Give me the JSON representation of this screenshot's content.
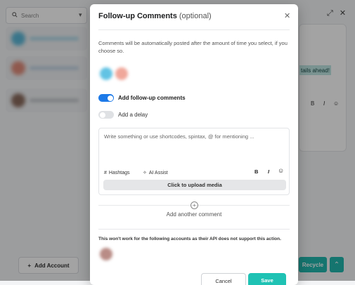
{
  "background": {
    "search": {
      "placeholder": "Search"
    },
    "add_account_label": "Add Account",
    "highlight_text": "tails ahead!",
    "recycle_label": "Recycle",
    "format_bold": "B",
    "format_italic": "I"
  },
  "modal": {
    "title": "Follow-up Comments",
    "title_optional": "(optional)",
    "description": "Comments will be automatically posted after the amount of time you select, if you choose so.",
    "toggles": {
      "follow_up": {
        "label": "Add follow-up comments",
        "on": true
      },
      "delay": {
        "label": "Add a delay",
        "on": false
      }
    },
    "editor": {
      "placeholder": "Write something or use shortcodes, spintax, @ for mentioning ...",
      "hashtags_label": "Hashtags",
      "ai_assist_label": "AI Assist",
      "bold_label": "B",
      "italic_label": "I",
      "upload_label": "Click to upload media"
    },
    "add_comment_label": "Add another comment",
    "unsupported_notice": "This won't work for the following accounts as their API does not support this action.",
    "buttons": {
      "cancel": "Cancel",
      "save": "Save"
    }
  },
  "colors": {
    "accent": "#1d7ae8",
    "save": "#1fc2b4",
    "recycle": "#22b8ae"
  }
}
